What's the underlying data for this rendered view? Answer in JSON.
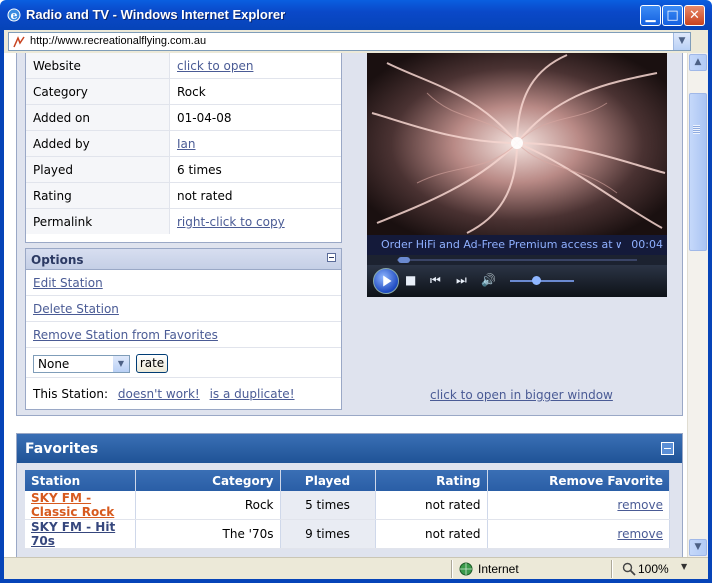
{
  "window": {
    "title": "Radio and TV - Windows Internet Explorer",
    "minimize_glyph": "▁",
    "maximize_glyph": "□",
    "close_glyph": "✕"
  },
  "address_bar": {
    "url": "http://www.recreationalflying.com.au"
  },
  "station_details": [
    {
      "label": "Website",
      "value": "click to open",
      "is_link": true
    },
    {
      "label": "Category",
      "value": "Rock",
      "is_link": false
    },
    {
      "label": "Added on",
      "value": "01-04-08",
      "is_link": false
    },
    {
      "label": "Added by",
      "value": "Ian",
      "is_link": true
    },
    {
      "label": "Played",
      "value": "6 times",
      "is_link": false
    },
    {
      "label": "Rating",
      "value": "not rated",
      "is_link": false
    },
    {
      "label": "Permalink",
      "value": "right-click to copy",
      "is_link": true
    }
  ],
  "options": {
    "title": "Options",
    "edit_station": "Edit Station",
    "delete_station": "Delete Station",
    "remove_favorite": "Remove Station from Favorites",
    "rating_selected": "None",
    "rate_button": "rate",
    "this_station_label": "This Station:",
    "doesnt_work": "doesn't work!",
    "is_duplicate": "is a duplicate!"
  },
  "player": {
    "caption": "Order HiFi and Ad-Free Premium access at ww...",
    "time": "00:04",
    "seek_progress": 0.03,
    "volume_level": 0.4
  },
  "bigger_window_link": "click to open in bigger window",
  "favorites": {
    "title": "Favorites",
    "columns": [
      "Station",
      "Category",
      "Played",
      "Rating",
      "Remove Favorite"
    ],
    "rows": [
      {
        "station": "SKY FM - Classic Rock",
        "category": "Rock",
        "played": "5 times",
        "rating": "not rated",
        "remove": "remove"
      },
      {
        "station": "SKY FM - Hit 70s",
        "category": "The '70s",
        "played": "9 times",
        "rating": "not rated",
        "remove": "remove"
      }
    ]
  },
  "status_bar": {
    "zone": "Internet",
    "zoom": "100%"
  },
  "colors": {
    "titlebar": "#0a48c8",
    "link": "#4a5b95",
    "active_station_link": "#d75a1e",
    "panel_header": "#2a5ea6"
  }
}
